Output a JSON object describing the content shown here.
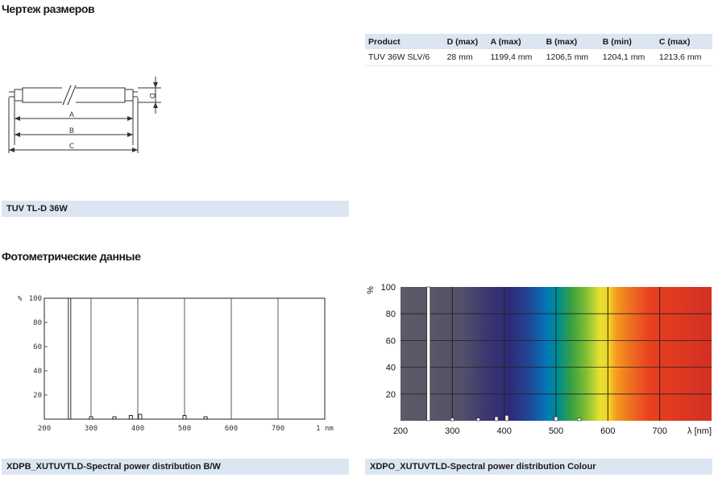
{
  "dimension_section": {
    "title": "Чертеж размеров",
    "drawing_labels": {
      "a": "A",
      "b": "B",
      "c": "C",
      "d": "D"
    },
    "caption": "TUV TL-D 36W"
  },
  "spec_table": {
    "headers": [
      "Product",
      "D (max)",
      "A (max)",
      "B (max)",
      "B (min)",
      "C (max)"
    ],
    "rows": [
      [
        "TUV 36W SLV/6",
        "28 mm",
        "1199,4 mm",
        "1206,5 mm",
        "1204,1 mm",
        "1213,6 mm"
      ]
    ]
  },
  "photometric_section": {
    "title": "Фотометрические данные"
  },
  "chart_data": [
    {
      "type": "bar",
      "ylabel": "%",
      "xlabel": "",
      "xlim": [
        200,
        800
      ],
      "ylim": [
        0,
        100
      ],
      "x_ticks": [
        "200",
        "300",
        "400",
        "500",
        "600",
        "700",
        "1 nm"
      ],
      "y_ticks": [
        "20",
        "40",
        "60",
        "80",
        "100"
      ],
      "grid": true,
      "x": [
        254,
        300,
        350,
        385,
        405,
        500,
        545
      ],
      "values": [
        100,
        2,
        2,
        3,
        4,
        3,
        2
      ],
      "caption": "XDPB_XUTUVTLD-Spectral power distribution B/W"
    },
    {
      "type": "bar",
      "ylabel": "%",
      "xlabel": "λ [nm]",
      "xlim": [
        200,
        800
      ],
      "ylim": [
        0,
        100
      ],
      "x_ticks": [
        "200",
        "300",
        "400",
        "500",
        "600",
        "700"
      ],
      "y_ticks": [
        "20",
        "40",
        "60",
        "80",
        "100"
      ],
      "grid": true,
      "background": "visible spectrum gradient",
      "x": [
        254,
        300,
        350,
        385,
        405,
        500,
        545
      ],
      "values": [
        100,
        2,
        2,
        3,
        4,
        3,
        2
      ],
      "caption": "XDPO_XUTUVTLD-Spectral power distribution Colour"
    }
  ]
}
